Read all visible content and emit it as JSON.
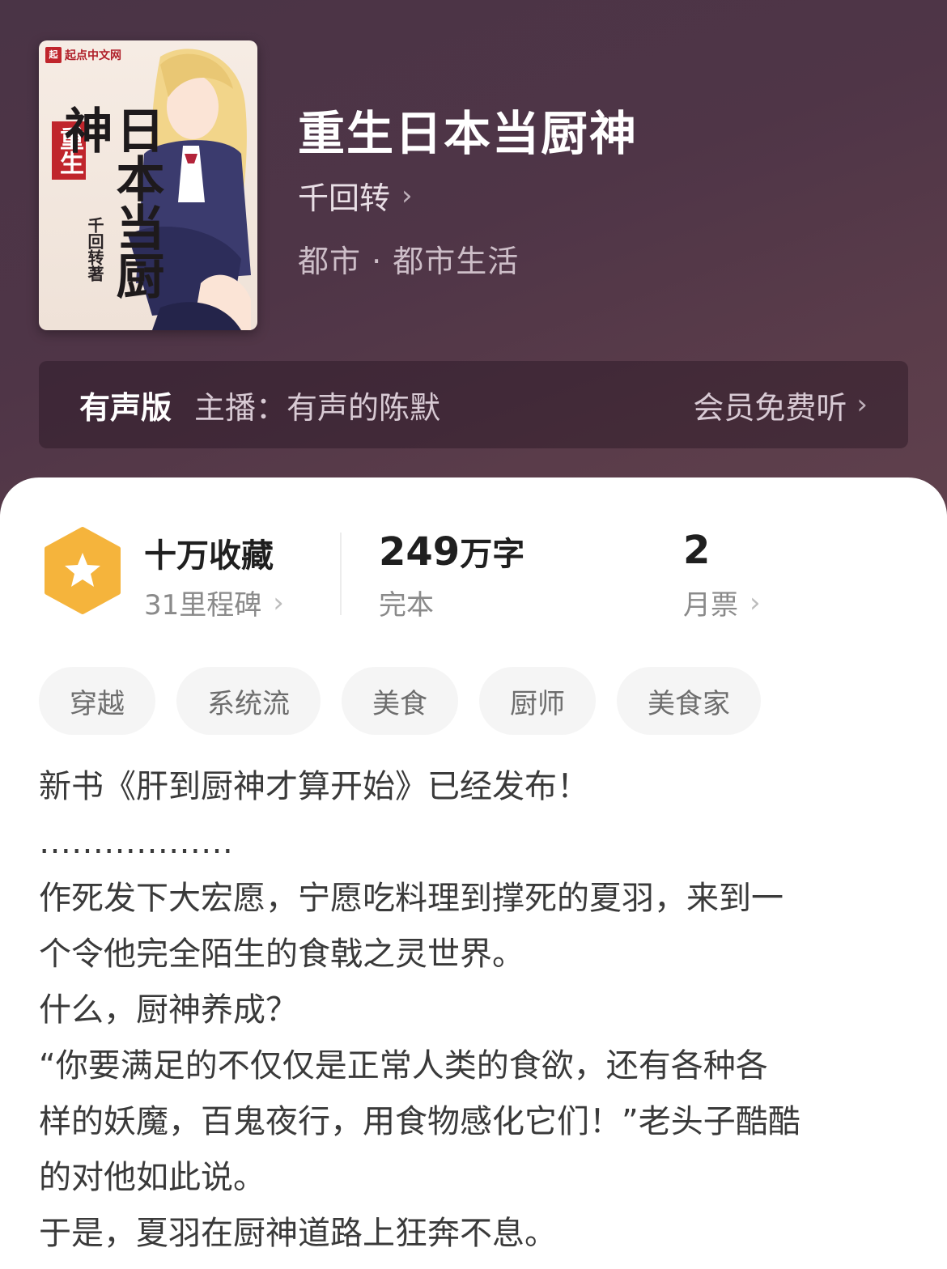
{
  "book": {
    "title": "重生日本当厨神",
    "author": "千回转",
    "genre": "都市 · 都市生活",
    "cover": {
      "brand": "起点中文网",
      "seal": "起",
      "title_main": "日本当厨神",
      "title_prefix": "重生",
      "author_line": "千回转著"
    }
  },
  "audio": {
    "tag": "有声版",
    "host": "主播：有声的陈默",
    "cta": "会员免费听"
  },
  "stats": {
    "collect_main": "十万收藏",
    "collect_sub": "31里程碑",
    "words_num": "249",
    "words_unit": "万字",
    "words_sub": "完本",
    "votes_num": "2",
    "votes_sub": "月票"
  },
  "tags": [
    "穿越",
    "系统流",
    "美食",
    "厨师",
    "美食家"
  ],
  "description": [
    "新书《肝到厨神才算开始》已经发布！",
    "………………",
    "作死发下大宏愿，宁愿吃料理到撑死的夏羽，来到一",
    "个令他完全陌生的食戟之灵世界。",
    "什么，厨神养成？",
    "“你要满足的不仅仅是正常人类的食欲，还有各种各",
    "样的妖魔，百鬼夜行，用食物感化它们！”老头子酷酷",
    "的对他如此说。",
    "于是，夏羽在厨神道路上狂奔不息。"
  ],
  "colors": {
    "hero_bg": "#4f3547",
    "badge": "#f5b43c",
    "text_dark": "#1f1f1f",
    "text_muted": "#8a8a8a"
  }
}
